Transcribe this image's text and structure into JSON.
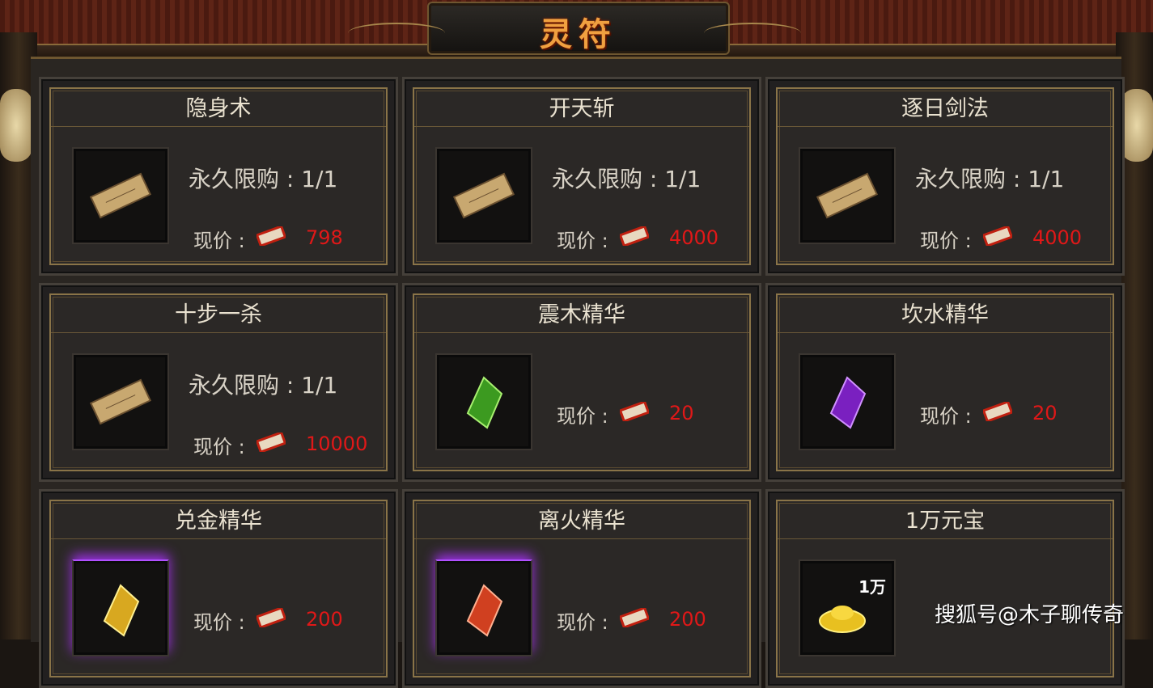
{
  "window": {
    "title": "灵符"
  },
  "colors": {
    "accent": "#f0a040",
    "price": "#e01818",
    "card_border": "#8a7448"
  },
  "items": [
    {
      "name": "隐身术",
      "limit": "永久限购 : 1/1",
      "price_label": "现价 :",
      "price": "798",
      "icon": "scroll-icon"
    },
    {
      "name": "开天斩",
      "limit": "永久限购 : 1/1",
      "price_label": "现价 :",
      "price": "4000",
      "icon": "scroll-icon"
    },
    {
      "name": "逐日剑法",
      "limit": "永久限购 : 1/1",
      "price_label": "现价 :",
      "price": "4000",
      "icon": "scroll-icon"
    },
    {
      "name": "十步一杀",
      "limit": "永久限购 : 1/1",
      "price_label": "现价 :",
      "price": "10000",
      "icon": "scroll-icon"
    },
    {
      "name": "震木精华",
      "limit": "",
      "price_label": "现价 :",
      "price": "20",
      "icon": "green-gem-icon"
    },
    {
      "name": "坎水精华",
      "limit": "",
      "price_label": "现价 :",
      "price": "20",
      "icon": "purple-gem-icon"
    },
    {
      "name": "兑金精华",
      "limit": "",
      "price_label": "现价 :",
      "price": "200",
      "icon": "gold-gem-icon"
    },
    {
      "name": "离火精华",
      "limit": "",
      "price_label": "现价 :",
      "price": "200",
      "icon": "red-gem-icon"
    },
    {
      "name": "1万元宝",
      "limit": "",
      "price_label": "",
      "price": "",
      "icon": "gold-ingot-icon",
      "icon_label": "1万"
    }
  ],
  "currency_icon": "red-ticket-icon",
  "watermark": "搜狐号@木子聊传奇"
}
